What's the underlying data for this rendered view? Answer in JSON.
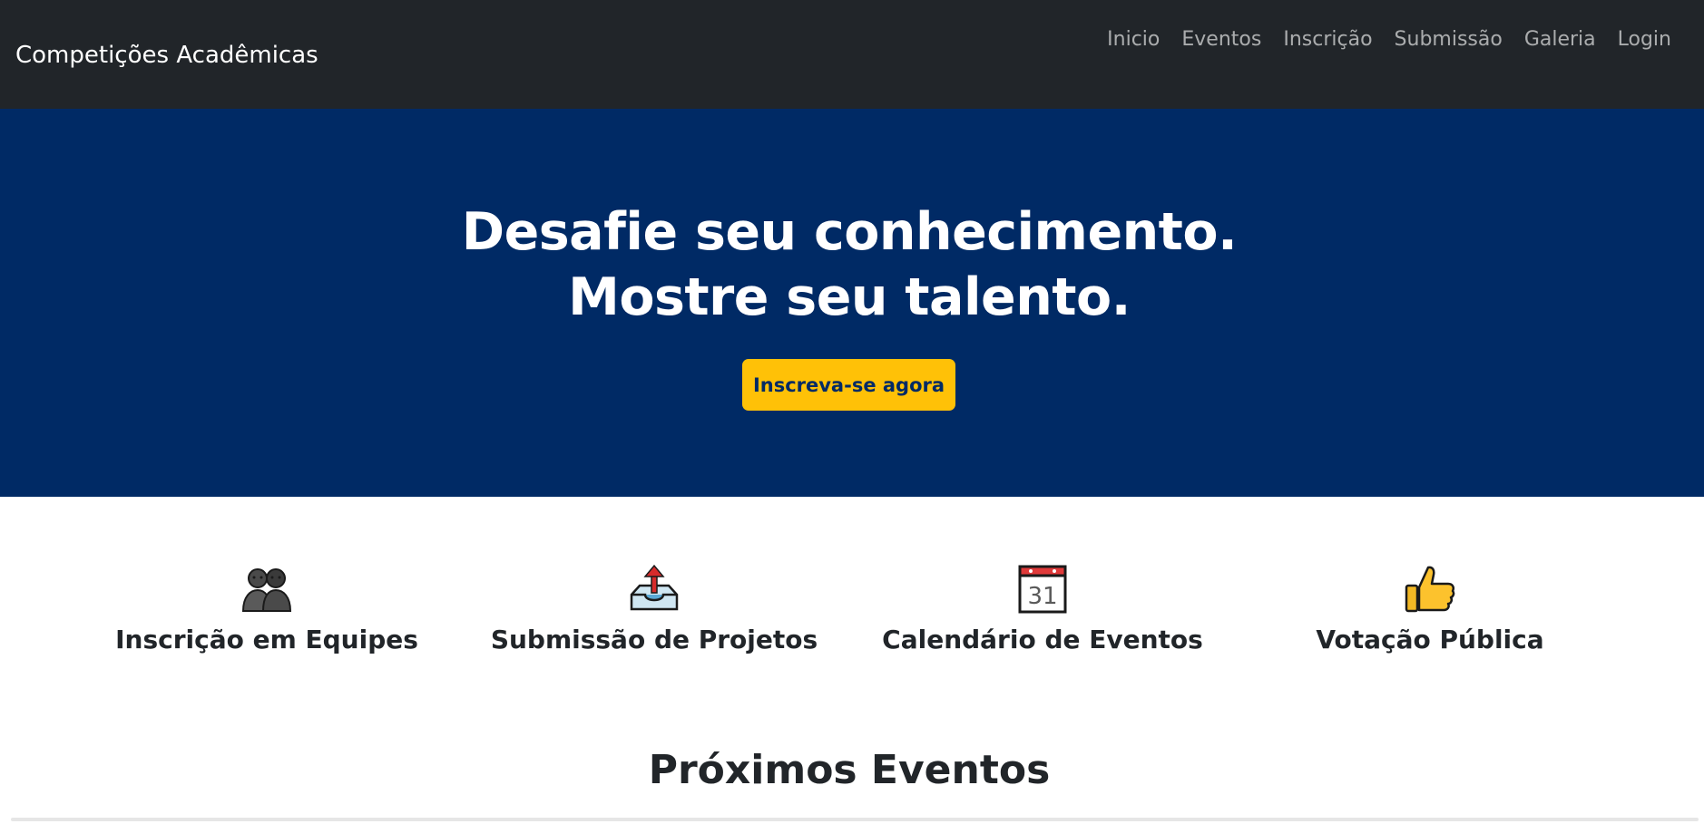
{
  "navbar": {
    "brand": "Competições Acadêmicas",
    "links": [
      "Inicio",
      "Eventos",
      "Inscrição",
      "Submissão",
      "Galeria",
      "Login"
    ]
  },
  "hero": {
    "title_line1": "Desafie seu conhecimento.",
    "title_line2": "Mostre seu talento.",
    "cta_label": "Inscreva-se agora"
  },
  "features": [
    {
      "icon": "two-people-icon",
      "label": "Inscrição em Equipes"
    },
    {
      "icon": "outbox-tray-icon",
      "label": "Submissão de Projetos"
    },
    {
      "icon": "calendar-icon",
      "calendar_day": "31",
      "label": "Calendário de Eventos"
    },
    {
      "icon": "thumbs-up-icon",
      "label": "Votação Pública"
    }
  ],
  "section": {
    "title": "Próximos Eventos"
  },
  "colors": {
    "navbar_bg": "#212529",
    "hero_bg": "#002a65",
    "cta_bg": "#ffc107",
    "text": "#212529"
  }
}
